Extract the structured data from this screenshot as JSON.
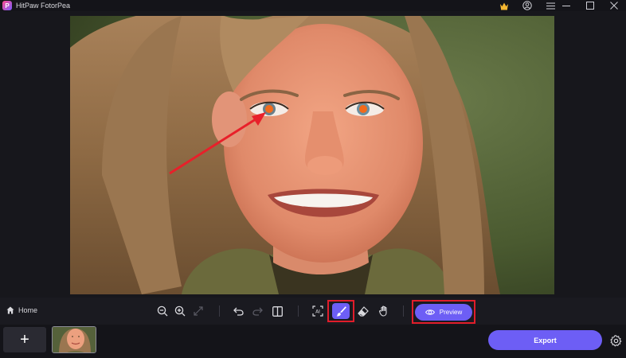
{
  "app": {
    "title": "HitPaw FotorPea",
    "logo_letter": "P"
  },
  "titlebar": {
    "icons": [
      "crown-icon",
      "user-icon",
      "menu-icon",
      "minimize-icon",
      "maximize-icon",
      "close-icon"
    ]
  },
  "toolbar": {
    "home_label": "Home",
    "tools": [
      "zoom-out-icon",
      "zoom-in-icon",
      "fit-screen-icon",
      "undo-icon",
      "redo-icon",
      "compare-icon",
      "ai-detect-icon",
      "brush-icon",
      "eraser-icon",
      "hand-icon"
    ],
    "preview_label": "Preview"
  },
  "bottombar": {
    "add_label": "+",
    "export_label": "Export"
  },
  "colors": {
    "accent": "#6d5ef5",
    "highlight": "#e11d2a",
    "background": "#141419"
  }
}
